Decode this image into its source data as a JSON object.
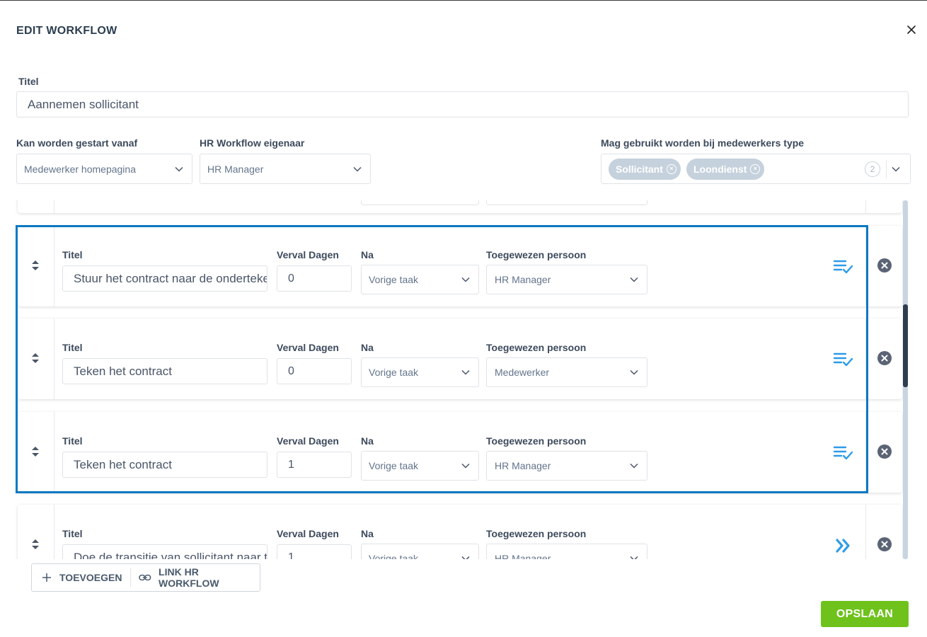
{
  "modal": {
    "title": "EDIT WORKFLOW"
  },
  "form": {
    "title_label": "Titel",
    "title_value": "Aannemen sollicitant",
    "start_label": "Kan worden gestart vanaf",
    "start_value": "Medewerker homepagina",
    "owner_label": "HR Workflow eigenaar",
    "owner_value": "HR Manager",
    "types_label": "Mag gebruikt worden bij medewerkers type",
    "types_tags": [
      "Sollicitant",
      "Loondienst"
    ],
    "types_count": "2"
  },
  "task_labels": {
    "title": "Titel",
    "days": "Verval Dagen",
    "after": "Na",
    "assignee": "Toegewezen persoon"
  },
  "tasks": [
    {
      "title": "Stuur het contract naar de ondertekenaar",
      "days": "0",
      "after": "Vorige taak",
      "assignee": "HR Manager",
      "action_icon": "checklist-icon"
    },
    {
      "title": "Teken het contract",
      "days": "0",
      "after": "Vorige taak",
      "assignee": "Medewerker",
      "action_icon": "checklist-icon"
    },
    {
      "title": "Teken het contract",
      "days": "1",
      "after": "Vorige taak",
      "assignee": "HR Manager",
      "action_icon": "checklist-icon"
    },
    {
      "title": "Doe de transitie van sollicitant naar to",
      "days": "1",
      "after": "Vorige taak",
      "assignee": "HR Manager",
      "action_icon": "double-chevron-right-icon"
    }
  ],
  "buttons": {
    "add": "TOEVOEGEN",
    "link": "LINK HR WORKFLOW",
    "save": "OPSLAAN"
  },
  "colors": {
    "accent_blue": "#0a78c2",
    "save_green": "#6fc21c",
    "icon_blue": "#2d9be8",
    "remove_gray": "#5b6474",
    "tag_bg": "#c5d1dc"
  }
}
